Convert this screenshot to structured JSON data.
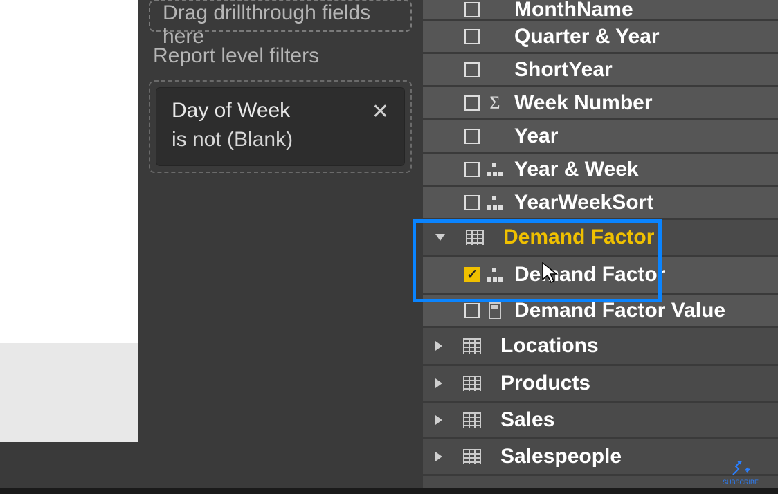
{
  "filters": {
    "drillthrough_placeholder": "Drag drillthrough fields here",
    "report_level_label": "Report level filters",
    "card": {
      "title": "Day of Week",
      "condition": "is not (Blank)"
    }
  },
  "fields": {
    "date_fields": {
      "month_name": "MonthName",
      "quarter_year": "Quarter & Year",
      "short_year": "ShortYear",
      "week_number": "Week Number",
      "year": "Year",
      "year_week": "Year & Week",
      "year_week_sort": "YearWeekSort"
    },
    "demand_factor": {
      "table": "Demand Factor",
      "field": "Demand Factor",
      "value": "Demand Factor Value"
    },
    "tables": {
      "locations": "Locations",
      "products": "Products",
      "sales": "Sales",
      "salespeople": "Salespeople"
    }
  },
  "subscribe": "SUBSCRIBE"
}
